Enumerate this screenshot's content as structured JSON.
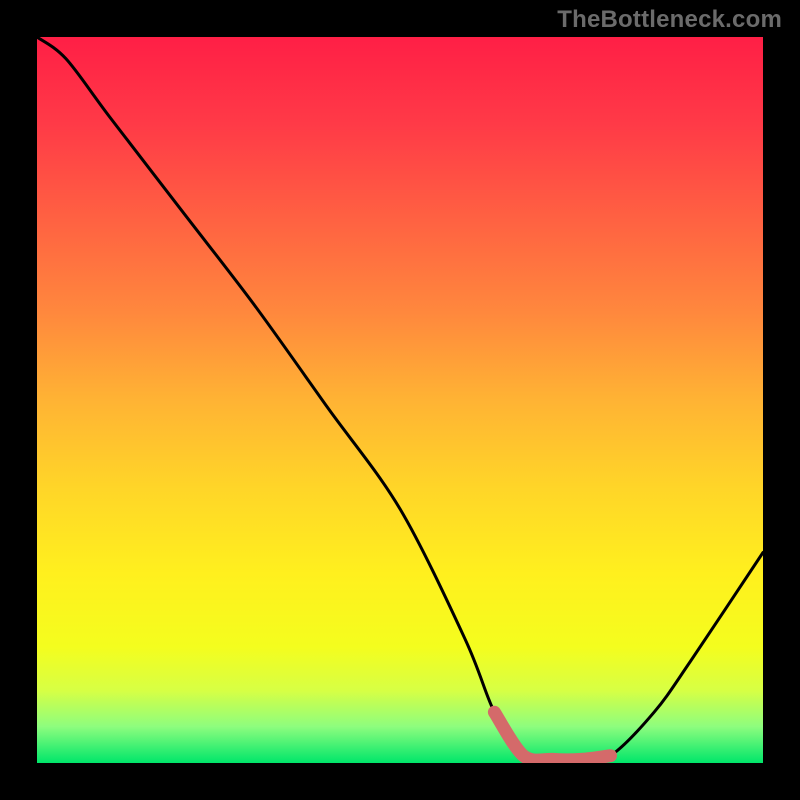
{
  "attribution": "TheBottleneck.com",
  "chart_data": {
    "type": "line",
    "title": "",
    "xlabel": "",
    "ylabel": "",
    "xlim": [
      0,
      100
    ],
    "ylim": [
      0,
      100
    ],
    "series": [
      {
        "name": "bottleneck-curve",
        "x": [
          0,
          4,
          10,
          20,
          30,
          40,
          50,
          59,
          63,
          67,
          71,
          75,
          79,
          85,
          90,
          100
        ],
        "y": [
          100,
          97,
          89,
          76,
          63,
          49,
          35,
          17,
          7,
          1,
          0.5,
          0.5,
          1,
          7,
          14,
          29
        ]
      },
      {
        "name": "optimal-band",
        "x": [
          63,
          67,
          71,
          75,
          79
        ],
        "y": [
          7,
          1,
          0.5,
          0.5,
          1
        ]
      }
    ],
    "gradient_stops": [
      {
        "pos": 0.0,
        "color": "#ff1f46"
      },
      {
        "pos": 0.12,
        "color": "#ff3a47"
      },
      {
        "pos": 0.25,
        "color": "#ff6142"
      },
      {
        "pos": 0.38,
        "color": "#ff883d"
      },
      {
        "pos": 0.5,
        "color": "#ffb334"
      },
      {
        "pos": 0.62,
        "color": "#ffd528"
      },
      {
        "pos": 0.74,
        "color": "#fff01e"
      },
      {
        "pos": 0.84,
        "color": "#f4fd1e"
      },
      {
        "pos": 0.9,
        "color": "#d7ff44"
      },
      {
        "pos": 0.95,
        "color": "#8dfd7e"
      },
      {
        "pos": 1.0,
        "color": "#00e66a"
      }
    ],
    "highlight_color": "#d46a6a",
    "curve_color": "#000000"
  }
}
